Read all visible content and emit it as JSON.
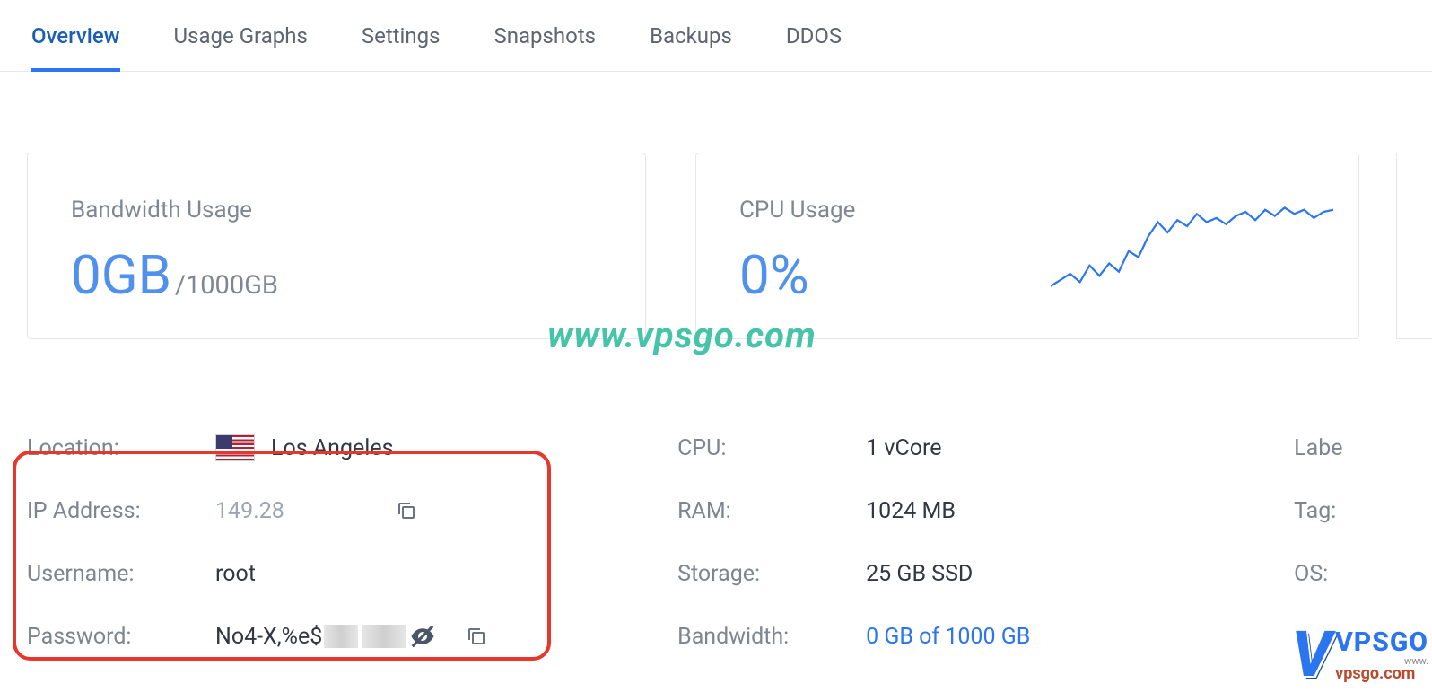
{
  "tabs": {
    "overview": "Overview",
    "usage_graphs": "Usage Graphs",
    "settings": "Settings",
    "snapshots": "Snapshots",
    "backups": "Backups",
    "ddos": "DDOS"
  },
  "cards": {
    "bandwidth": {
      "title": "Bandwidth Usage",
      "value": "0GB",
      "of": "/1000GB"
    },
    "cpu": {
      "title": "CPU Usage",
      "value": "0%"
    }
  },
  "watermark": "www.vpsgo.com",
  "details": {
    "location_label": "Location:",
    "location_value": "Los Angeles",
    "ip_label": "IP Address:",
    "ip_value": "149.28",
    "username_label": "Username:",
    "username_value": "root",
    "password_label": "Password:",
    "password_value": "No4-X,%e$",
    "cpu_label": "CPU:",
    "cpu_value": "1 vCore",
    "ram_label": "RAM:",
    "ram_value": "1024 MB",
    "storage_label": "Storage:",
    "storage_value": "25 GB SSD",
    "bandwidth_label": "Bandwidth:",
    "bandwidth_value": "0 GB of 1000 GB",
    "label_label": "Labe",
    "tag_label": "Tag:",
    "os_label": "OS:"
  },
  "brand": {
    "top": "VPSGO",
    "www": "www.",
    "bottom": "vpsgo.com"
  },
  "chart_data": {
    "type": "line",
    "title": "CPU Usage",
    "ylabel": "",
    "xlabel": "",
    "ylim": [
      0,
      100
    ],
    "x": [
      0,
      1,
      2,
      3,
      4,
      5,
      6,
      7,
      8,
      9,
      10,
      11,
      12,
      13,
      14,
      15,
      16,
      17,
      18,
      19,
      20,
      21,
      22,
      23,
      24,
      25,
      26,
      27,
      28,
      29
    ],
    "values": [
      8,
      14,
      20,
      12,
      28,
      18,
      30,
      22,
      42,
      36,
      56,
      70,
      60,
      72,
      66,
      78,
      70,
      74,
      68,
      76,
      80,
      72,
      82,
      76,
      84,
      78,
      82,
      74,
      80,
      82
    ]
  }
}
